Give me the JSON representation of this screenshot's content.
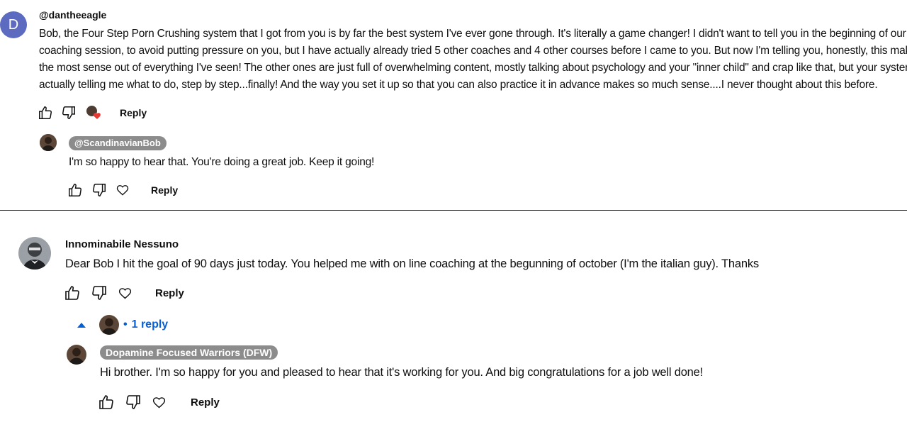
{
  "comment1": {
    "avatar_letter": "D",
    "author": "@dantheeagle",
    "lines": [
      "Bob, the Four Step Porn Crushing system that I got from you is by far the best system I've ever gone through. It's literally a game changer! I didn't want to tell you in the beginning of our first",
      "coaching session, to avoid putting pressure on you, but I have actually already tried 5 other coaches and 4 other courses before I came to you. But now I'm telling you, honestly, this makes",
      "the most sense out of everything I've seen! The other ones are just full of overwhelming content, mostly talking about psychology and your \"inner child\" and crap like that, but your system is",
      "actually telling me what to do, step by step...finally! And the way you set it up so that you can also practice it in advance makes so much sense....I never thought about this before."
    ],
    "reply_label": "Reply"
  },
  "reply1": {
    "author": "@ScandinavianBob",
    "text": "I'm so happy to hear that. You're doing a great job. Keep it going!",
    "reply_label": "Reply"
  },
  "comment2": {
    "author": "Innominabile Nessuno",
    "text": "Dear Bob I hit the goal of 90 days just today. You helped me with on line coaching at the begunning of october (I'm the italian guy). Thanks",
    "reply_label": "Reply",
    "replies_count": "1 reply",
    "replies_separator": "•"
  },
  "reply2": {
    "author": "Dopamine Focused Warriors (DFW)",
    "text": "Hi brother. I'm so happy for you and pleased to hear that it's working for you. And big congratulations for a job well done!",
    "reply_label": "Reply"
  },
  "colors": {
    "avatar_d": "#5c6bc0",
    "link_blue": "#065fd4",
    "pill_bg": "#8c8c8c",
    "heart_red": "#e53935"
  }
}
